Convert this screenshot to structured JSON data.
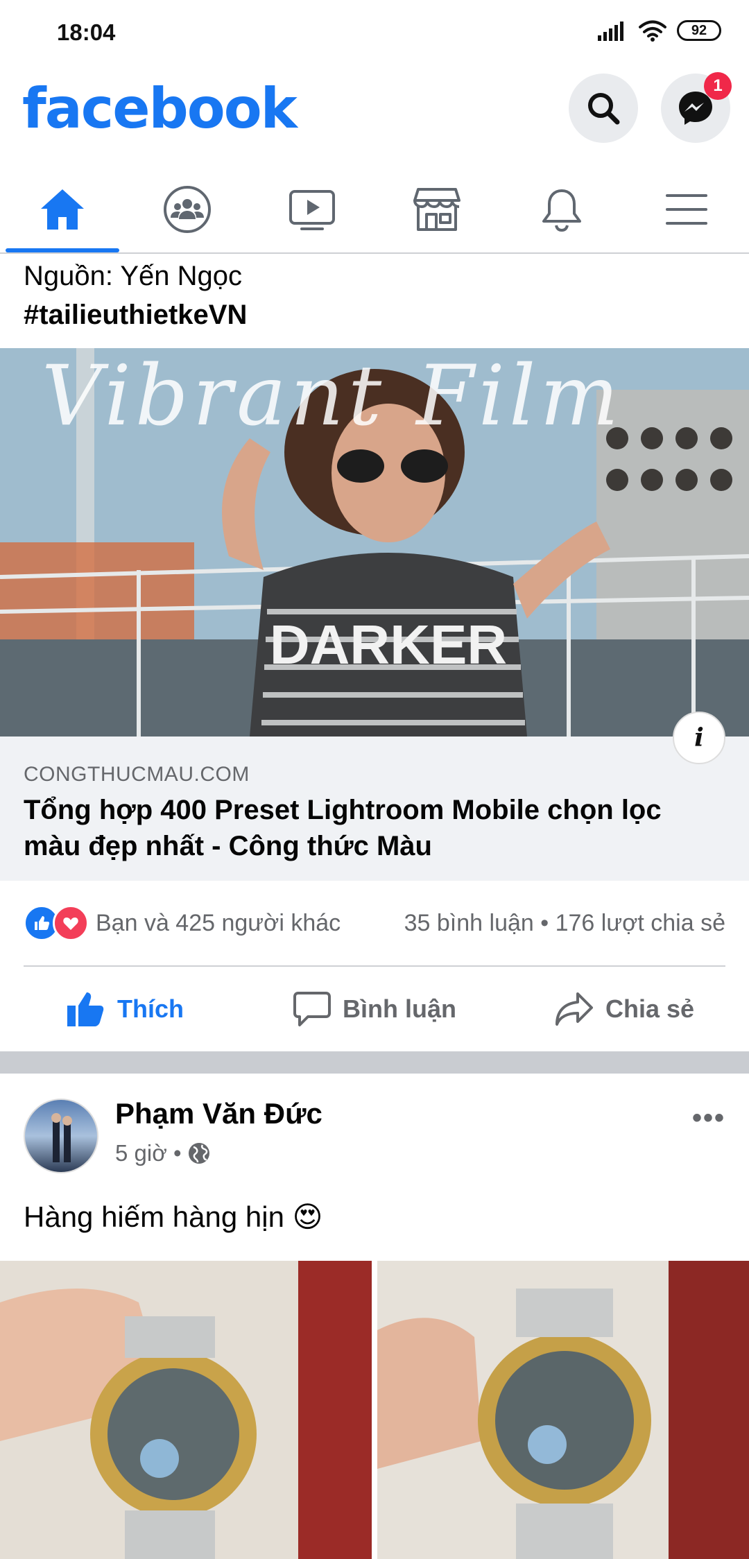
{
  "status_bar": {
    "time": "18:04",
    "battery": "92"
  },
  "header": {
    "logo": "facebook",
    "messenger_badge": "1"
  },
  "tabs": [
    {
      "name": "home",
      "icon": "home-icon",
      "active": true
    },
    {
      "name": "groups",
      "icon": "groups-icon",
      "active": false
    },
    {
      "name": "watch",
      "icon": "video-icon",
      "active": false
    },
    {
      "name": "marketplace",
      "icon": "store-icon",
      "active": false
    },
    {
      "name": "notifications",
      "icon": "bell-icon",
      "active": false
    },
    {
      "name": "menu",
      "icon": "menu-icon",
      "active": false
    }
  ],
  "post1": {
    "source_line": "Nguồn: Yến Ngọc",
    "hashtag": "#tailieuthietkeVN",
    "image_overlay_script": "Vibrant Film",
    "image_overlay_word": "DARKER",
    "link_domain": "CONGTHUCMAU.COM",
    "link_title": "Tổng hợp 400 Preset Lightroom Mobile chọn lọc màu đẹp nhất - Công thức Màu",
    "reactions_text": "Bạn và 425 người khác",
    "comments_shares": "35 bình luận • 176 lượt chia sẻ",
    "actions": {
      "like": "Thích",
      "comment": "Bình luận",
      "share": "Chia sẻ"
    }
  },
  "post2": {
    "author": "Phạm Văn Đức",
    "time": "5 giờ •",
    "text": "Hàng hiếm hàng hịn 😍"
  },
  "colors": {
    "brand": "#1877f2",
    "badge": "#f02849",
    "love": "#f33e58"
  }
}
